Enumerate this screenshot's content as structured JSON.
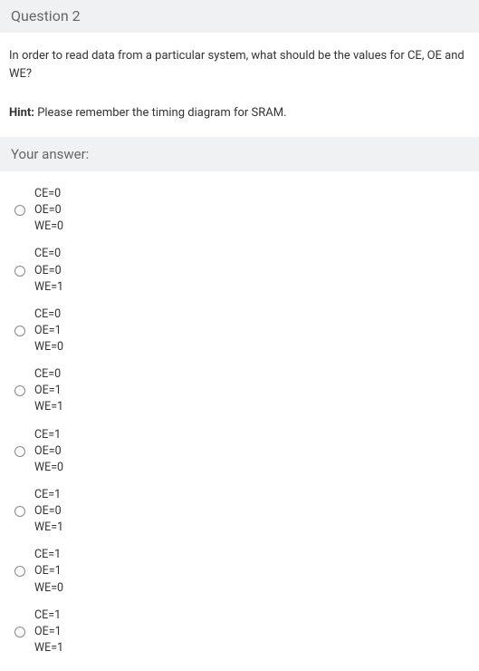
{
  "header": {
    "title": "Question 2"
  },
  "question": "In order to read data from a particular system, what should be the values for CE, OE and WE?",
  "hint": {
    "label": "Hint:",
    "text": " Please remember the timing diagram for SRAM."
  },
  "answer_header": "Your answer:",
  "options": [
    {
      "line1": "CE=0",
      "line2": "OE=0",
      "line3": "WE=0"
    },
    {
      "line1": "CE=0",
      "line2": "OE=0",
      "line3": "WE=1"
    },
    {
      "line1": "CE=0",
      "line2": "OE=1",
      "line3": "WE=0"
    },
    {
      "line1": "CE=0",
      "line2": "OE=1",
      "line3": "WE=1"
    },
    {
      "line1": "CE=1",
      "line2": "OE=0",
      "line3": "WE=0"
    },
    {
      "line1": "CE=1",
      "line2": "OE=0",
      "line3": "WE=1"
    },
    {
      "line1": "CE=1",
      "line2": "OE=1",
      "line3": "WE=0"
    },
    {
      "line1": "CE=1",
      "line2": "OE=1",
      "line3": "WE=1"
    }
  ]
}
